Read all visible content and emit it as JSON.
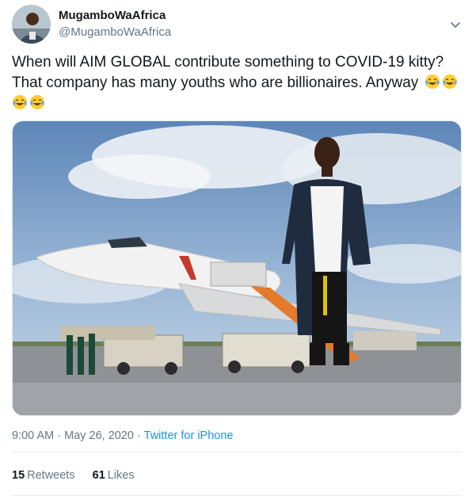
{
  "author": {
    "display_name": "MugamboWaAfrica",
    "handle": "@MugamboWaAfrica"
  },
  "tweet": {
    "text_line1": "When will AIM GLOBAL contribute something to COVID-19 kitty?",
    "text_line2": "That company has many youths who are billionaires. Anyway",
    "emoji": [
      "face-with-tears-of-joy",
      "face-with-tears-of-joy",
      "face-with-tears-of-joy",
      "face-with-tears-of-joy"
    ]
  },
  "meta": {
    "time": "9:00 AM",
    "separator": "·",
    "date": "May 26, 2020",
    "source": "Twitter for iPhone"
  },
  "stats": {
    "retweets_count": "15",
    "retweets_label": "Retweets",
    "likes_count": "61",
    "likes_label": "Likes"
  },
  "colors": {
    "text": "#14171a",
    "secondary": "#657786",
    "link": "#1b95e0",
    "divider": "#e6ecf0"
  },
  "icons": {
    "caret": "chevron-down-icon"
  }
}
